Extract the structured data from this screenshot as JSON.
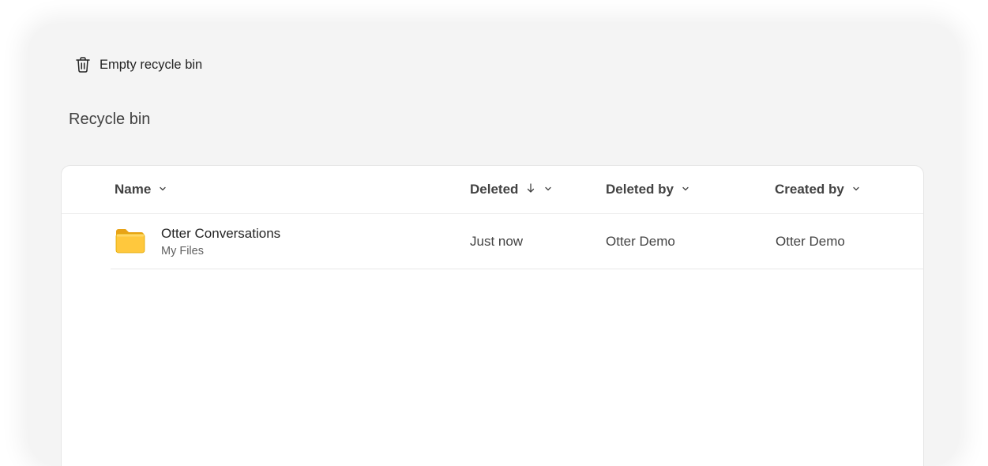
{
  "toolbar": {
    "empty_label": "Empty recycle bin",
    "empty_icon": "trash-icon"
  },
  "page": {
    "title": "Recycle bin"
  },
  "table": {
    "columns": [
      {
        "label": "Name",
        "sortable": true
      },
      {
        "label": "Deleted",
        "sorted": "descending"
      },
      {
        "label": "Deleted by"
      },
      {
        "label": "Created by"
      }
    ],
    "rows": [
      {
        "icon": "folder-icon",
        "name": "Otter Conversations",
        "location": "My Files",
        "deleted": "Just now",
        "deleted_by": "Otter Demo",
        "created_by": "Otter Demo"
      }
    ]
  },
  "colors": {
    "panel_bg": "#f4f4f4",
    "folder_yellow": "#FFC83D",
    "folder_tab": "#F5A623",
    "text_primary": "#242424",
    "text_secondary": "#616161"
  }
}
